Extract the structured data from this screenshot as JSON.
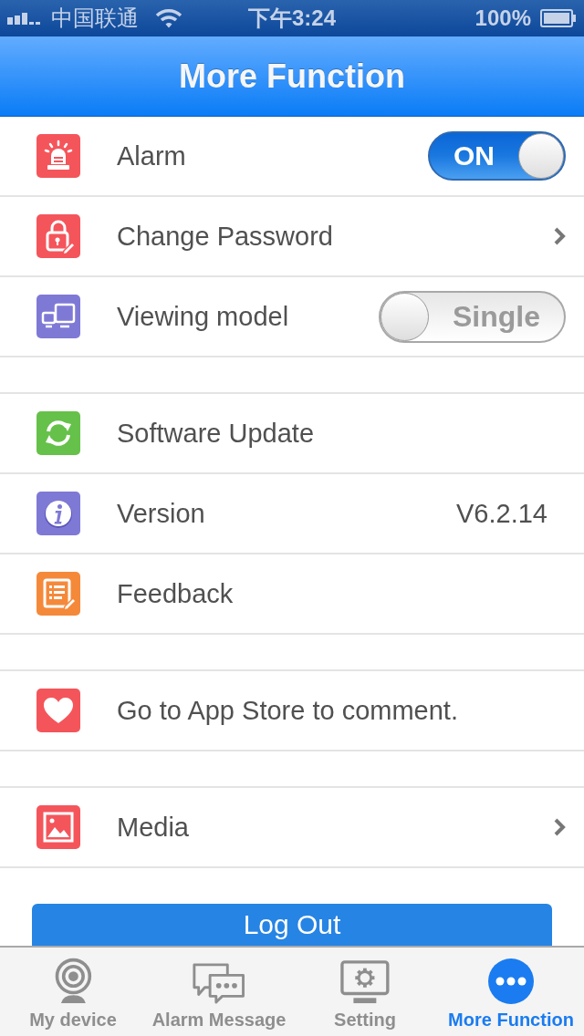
{
  "status_bar": {
    "carrier": "中国联通",
    "time": "下午3:24",
    "battery": "100%"
  },
  "nav_bar": {
    "title": "More Function"
  },
  "sections": [
    {
      "rows": [
        {
          "kind": "switch",
          "label": "Alarm",
          "color": "#f4555b",
          "on": true,
          "switch_text": "ON"
        },
        {
          "kind": "link",
          "label": "Change Password",
          "color": "#f4555b"
        },
        {
          "kind": "switch",
          "label": "Viewing model",
          "color": "#7f79d6",
          "on": false,
          "switch_text": "Single"
        }
      ]
    },
    {
      "rows": [
        {
          "kind": "plain",
          "label": "Software Update",
          "color": "#66c14a"
        },
        {
          "kind": "value",
          "label": "Version",
          "color": "#7f79d6",
          "value": "V6.2.14"
        },
        {
          "kind": "plain",
          "label": "Feedback",
          "color": "#f5893a"
        }
      ]
    },
    {
      "rows": [
        {
          "kind": "plain",
          "label": "Go to App Store to comment.",
          "color": "#f4555b"
        }
      ]
    },
    {
      "rows": [
        {
          "kind": "link",
          "label": "Media",
          "color": "#f4555b"
        }
      ]
    }
  ],
  "log_out_button": "Log Out",
  "tab_bar": [
    {
      "label": "My device",
      "selected": false
    },
    {
      "label": "Alarm Message",
      "selected": false
    },
    {
      "label": "Setting",
      "selected": false
    },
    {
      "label": "More Function",
      "selected": true
    }
  ]
}
